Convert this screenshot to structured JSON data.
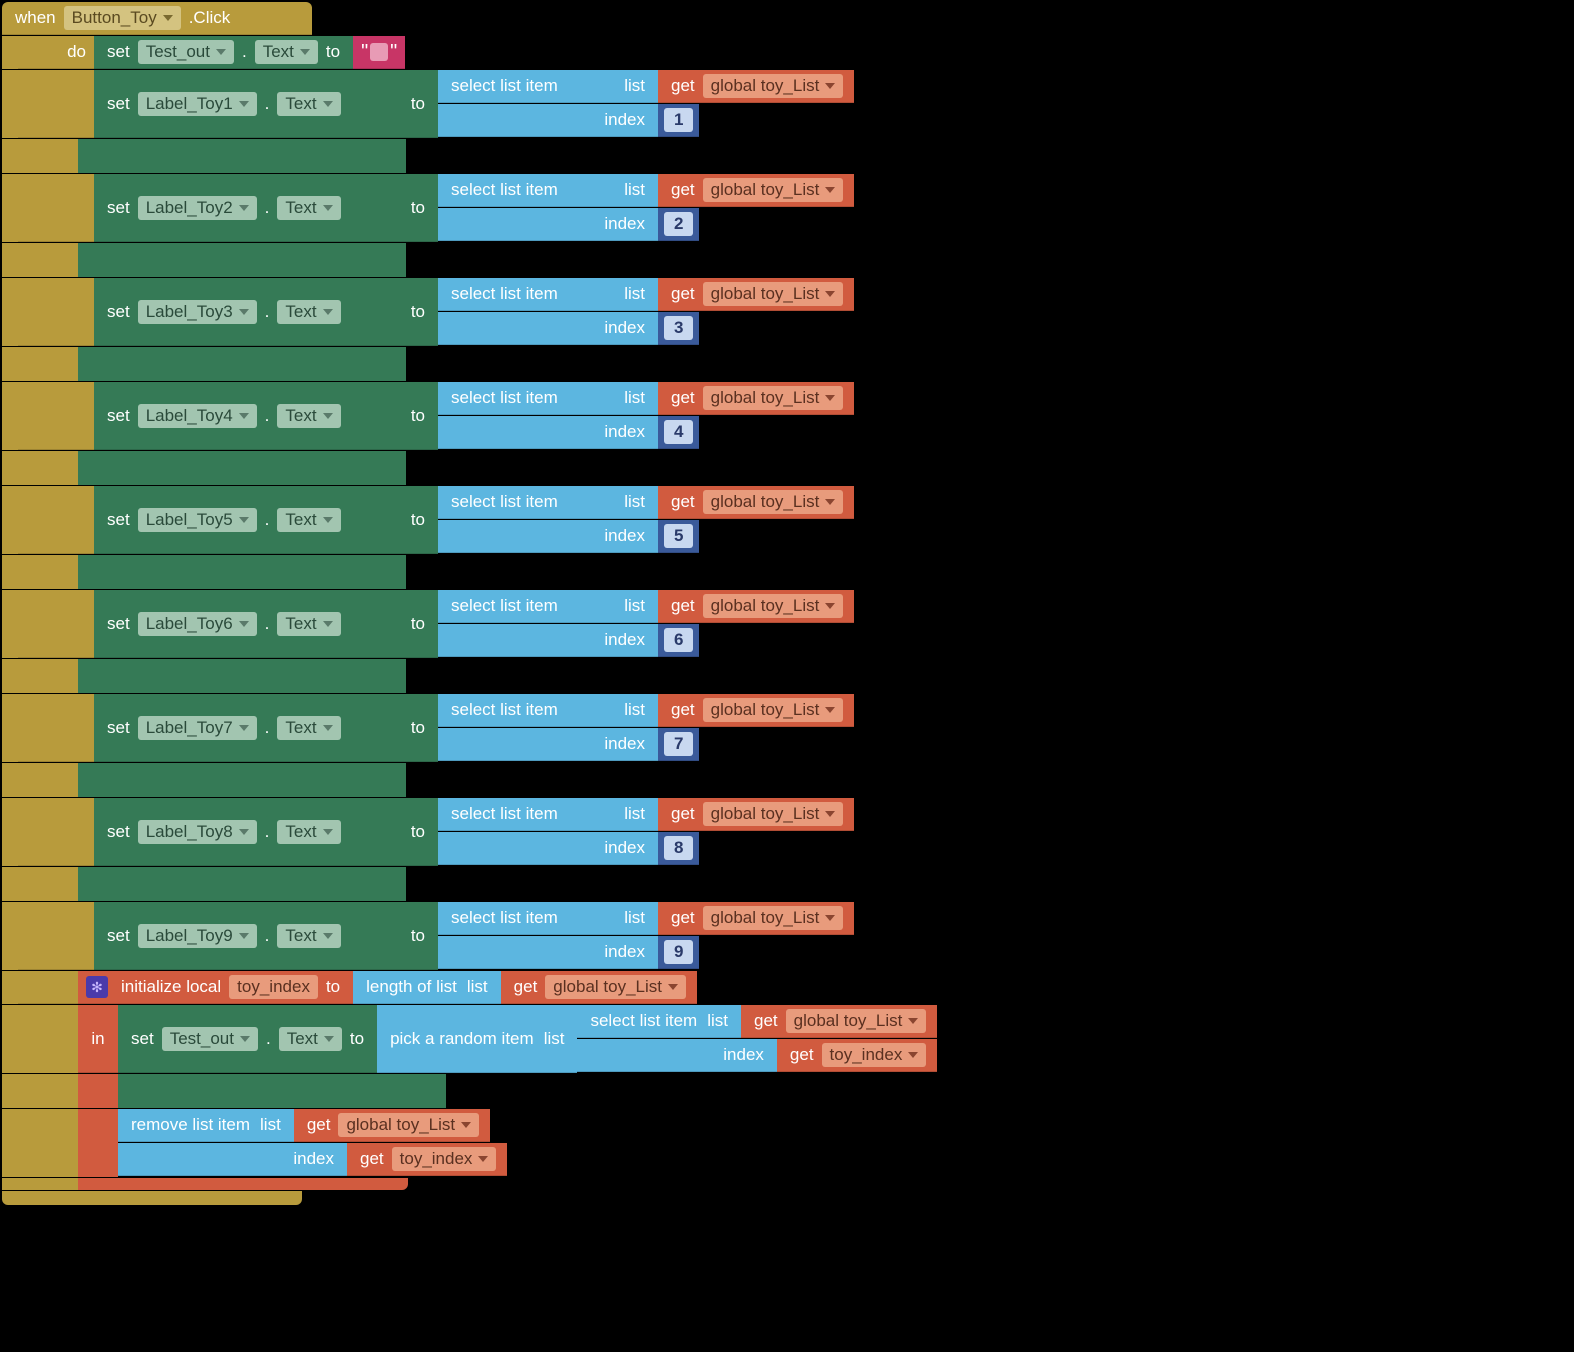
{
  "when": "when",
  "click": ".Click",
  "component": "Button_Toy",
  "do": "do",
  "in": "in",
  "set": "set",
  "dot": ".",
  "to": "to",
  "text": "Text",
  "get": "get",
  "sel": "select list item",
  "list": "list",
  "index": "index",
  "len": "length of list",
  "pick": "pick a random item",
  "remove": "remove list item",
  "initLocal": "initialize local",
  "localVar": "toy_index",
  "globalList": "global toy_List",
  "toyIdx": "toy_index",
  "rows": [
    {
      "comp": "Test_out",
      "literal": true
    },
    {
      "comp": "Label_Toy1",
      "idx": "1"
    },
    {
      "comp": "Label_Toy2",
      "idx": "2"
    },
    {
      "comp": "Label_Toy3",
      "idx": "3"
    },
    {
      "comp": "Label_Toy4",
      "idx": "4"
    },
    {
      "comp": "Label_Toy5",
      "idx": "5"
    },
    {
      "comp": "Label_Toy6",
      "idx": "6"
    },
    {
      "comp": "Label_Toy7",
      "idx": "7"
    },
    {
      "comp": "Label_Toy8",
      "idx": "8"
    },
    {
      "comp": "Label_Toy9",
      "idx": "9"
    }
  ],
  "innerComp": "Test_out"
}
